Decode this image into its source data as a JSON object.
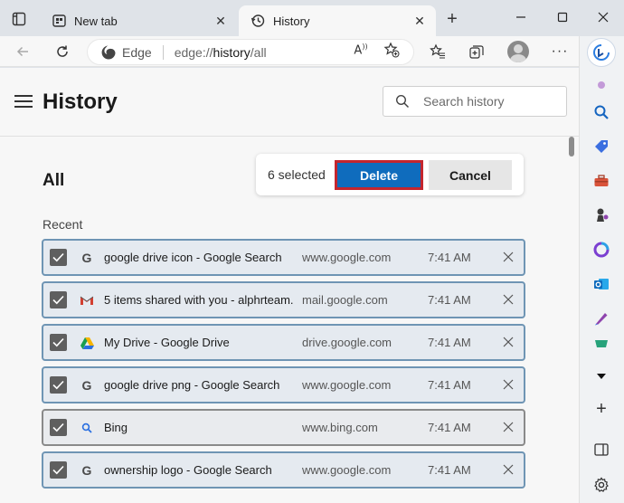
{
  "tabs": [
    {
      "title": "New tab",
      "icon": "new-tab-icon",
      "active": false
    },
    {
      "title": "History",
      "icon": "history-icon",
      "active": true
    }
  ],
  "address": {
    "site_label": "Edge",
    "url_prefix": "edge://",
    "url_bold": "history",
    "url_suffix": "/all"
  },
  "header": {
    "title": "History",
    "search_placeholder": "Search history"
  },
  "section": {
    "title": "All",
    "subtitle": "Recent"
  },
  "selection": {
    "count_text": "6 selected",
    "delete_label": "Delete",
    "cancel_label": "Cancel"
  },
  "rows": [
    {
      "title": "google drive icon - Google Search",
      "domain": "www.google.com",
      "time": "7:41 AM",
      "favicon": "google-icon",
      "checked": true
    },
    {
      "title": "5 items shared with you - alphrteam...",
      "domain": "mail.google.com",
      "time": "7:41 AM",
      "favicon": "gmail-icon",
      "checked": true
    },
    {
      "title": "My Drive - Google Drive",
      "domain": "drive.google.com",
      "time": "7:41 AM",
      "favicon": "google-drive-icon",
      "checked": true
    },
    {
      "title": "google drive png - Google Search",
      "domain": "www.google.com",
      "time": "7:41 AM",
      "favicon": "google-icon",
      "checked": true
    },
    {
      "title": "Bing",
      "domain": "www.bing.com",
      "time": "7:41 AM",
      "favicon": "bing-search-icon",
      "checked": true
    },
    {
      "title": "ownership logo - Google Search",
      "domain": "www.google.com",
      "time": "7:41 AM",
      "favicon": "google-icon",
      "checked": true
    }
  ],
  "colors": {
    "accent": "#0f6cbd",
    "highlight_border": "#c4262e",
    "row_border": "#6f95b4"
  }
}
